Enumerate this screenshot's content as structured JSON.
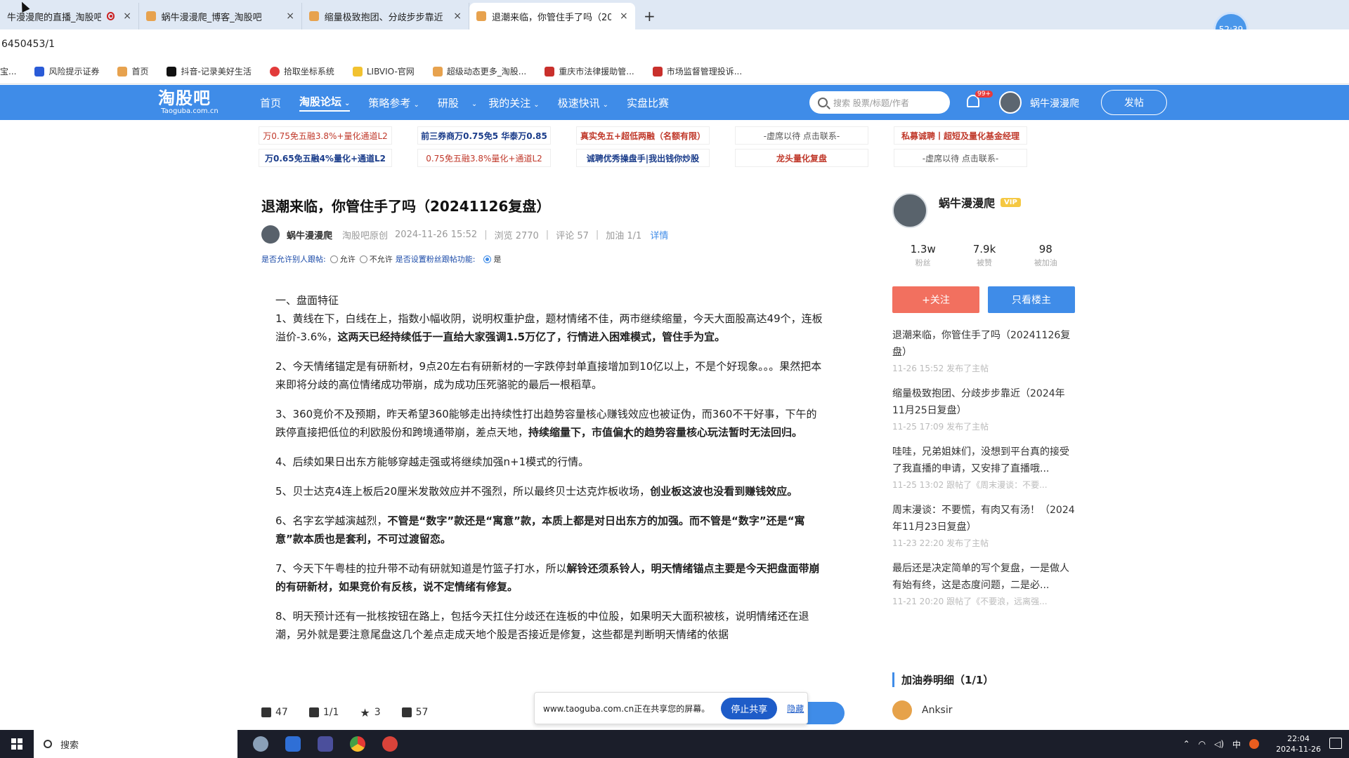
{
  "browser": {
    "tabs": [
      {
        "title": "牛漫漫爬的直播_淘股吧1",
        "recording": true
      },
      {
        "title": "蜗牛漫漫爬_博客_淘股吧"
      },
      {
        "title": "缩量极致抱团、分歧步步靠近"
      },
      {
        "title": "退潮来临，你管住手了吗（202",
        "active": true
      }
    ],
    "new_tab": "+",
    "close_glyph": "×",
    "timer": "52:39",
    "address": "6450453/1",
    "bookmarks": [
      "宝...",
      "风险提示证券",
      "首页",
      "抖音-记录美好生活",
      "拾取坐标系统",
      "LIBVIO-官网",
      "超级动态更多_淘股...",
      "重庆市法律援助管...",
      "市场监督管理投诉..."
    ]
  },
  "site_nav": {
    "logo_main": "淘股吧",
    "logo_sub": "Taoguba.com.cn",
    "items": [
      "首页",
      "淘股论坛",
      "策略参考",
      "研股",
      "我的关注",
      "极速快讯",
      "实盘比赛"
    ],
    "dropdown_glyph": "⌄",
    "search_placeholder": "搜索 股票/标题/作者",
    "notify_badge": "99+",
    "username": "蜗牛漫漫爬",
    "post_button": "发帖"
  },
  "ads": [
    [
      "万0.75免五融3.8%+量化通道L2",
      "前三券商万0.75免5 华泰万0.85",
      "真实免五+超低两融（名额有限）",
      "-虚席以待 点击联系-",
      "私募诚聘丨超短及量化基金经理"
    ],
    [
      "万0.65免五融4%量化+通道L2",
      "0.75免五融3.8%量化+通道L2",
      "诚聘优秀操盘手|我出钱你炒股",
      "龙头量化复盘",
      "-虚席以待 点击联系-"
    ]
  ],
  "article": {
    "title": "退潮来临，你管住手了吗（20241126复盘）",
    "author": "蜗牛漫漫爬",
    "source": "淘股吧原创",
    "datetime": "2024-11-26 15:52",
    "views": "浏览 2770",
    "comments": "评论 57",
    "boost": "加油 1/1",
    "detail": "详情",
    "follow_q1": "是否允许别人跟帖:",
    "allow": "允许",
    "disallow": "不允许",
    "follow_q2": "是否设置粉丝跟帖功能:",
    "yes": "是",
    "section": "一、盘面特征",
    "paragraphs": [
      {
        "normal": "1、黄线在下，白线在上，指数小幅收阴，说明权重护盘，题材情绪不佳，两市继续缩量，今天大面股高达49个，连板溢价-3.6%，",
        "bold": "这两天已经持续低于一直给大家强调1.5万亿了，行情进入困难模式，管住手为宜。",
        "tail": ""
      },
      {
        "normal": "2、今天情绪锚定是有研新材，9点20左右有研新材的一字跌停封单直接增加到10亿以上，不是个好现象。。。果然把本来即将分歧的高位情绪成功带崩，成为成功压死骆驼的最后一根稻草。",
        "bold": "",
        "tail": ""
      },
      {
        "normal": "3、360竞价不及预期，昨天希望360能够走出持续性打出趋势容量核心赚钱效应也被证伪，而360不干好事，下午的跌停直接把低位的利欧股份和跨境通带崩，差点天地，",
        "bold": "持续缩量下，市值偏大的趋势容量核心玩法暂时无法回归。",
        "tail": ""
      },
      {
        "normal": "4、后续如果日出东方能够穿越走强或将继续加强n+1模式的行情。",
        "bold": "",
        "tail": ""
      },
      {
        "normal": "5、贝士达克4连上板后20厘米发散效应并不强烈，所以最终贝士达克炸板收场，",
        "bold": "创业板这波也没看到赚钱效应。",
        "tail": ""
      },
      {
        "normal": "6、名字玄学越演越烈，",
        "bold": "不管是“数字”款还是“寓意”款，本质上都是对日出东方的加强。而不管是“数字”还是“寓意”款本质也是套利，不可过渡留恋。",
        "tail": ""
      },
      {
        "normal": "7、今天下午粤桂的拉升带不动有研就知道是竹篮子打水，所以",
        "bold": "解铃还须系铃人，明天情绪锚点主要是今天把盘面带崩的有研新材，如果竞价有反核，说不定情绪有修复。",
        "tail": ""
      },
      {
        "normal": "8、明天预计还有一批核按钮在路上，包括今天扛住分歧还在连板的中位股，如果明天大面积被核，说明情绪还在退潮，另外就是要注意尾盘这几个差点走成天地个股是否接近是修复，这些都是判断明天情绪的依据",
        "bold": "",
        "tail": ""
      }
    ]
  },
  "stats": {
    "likes": "47",
    "pages": "1/1",
    "stars": "3",
    "comments": "57"
  },
  "share_bar": {
    "text": "www.taoguba.com.cn正在共享您的屏幕。",
    "stop": "停止共享",
    "hide": "隐藏"
  },
  "sidebar": {
    "name": "蜗牛漫漫爬",
    "vip": "VIP",
    "stats": [
      {
        "value": "1.3w",
        "label": "粉丝"
      },
      {
        "value": "7.9k",
        "label": "被赞"
      },
      {
        "value": "98",
        "label": "被加油"
      }
    ],
    "follow": "+关注",
    "only_author": "只看楼主",
    "posts": [
      {
        "title": "退潮来临，你管住手了吗（20241126复盘）",
        "meta": "11-26 15:52 发布了主帖"
      },
      {
        "title": "缩量极致抱团、分歧步步靠近（2024年11月25日复盘）",
        "meta": "11-25 17:09 发布了主帖"
      },
      {
        "title": "哇哇，兄弟姐妹们，没想到平台真的接受了我直播的申请，又安排了直播哦...",
        "meta": "11-25 13:02 跟帖了《周末漫谈：不要..."
      },
      {
        "title": "周末漫谈：不要慌，有肉又有汤！（2024年11月23日复盘）",
        "meta": "11-23 22:20 发布了主帖"
      },
      {
        "title": "最后还是决定简单的写个复盘，一是做人有始有终，这是态度问题，二是必...",
        "meta": "11-21 20:20 跟帖了《不要浪，远离强..."
      }
    ],
    "section": "加油券明细（1/1）",
    "booster": "Anksir"
  },
  "taskbar": {
    "search": "搜索",
    "ime": "中",
    "time": "22:04",
    "date": "2024-11-26"
  },
  "colors": {
    "brand": "#3f8ce8",
    "follow": "#f2705f",
    "taskbar": "#1b1e2a"
  }
}
